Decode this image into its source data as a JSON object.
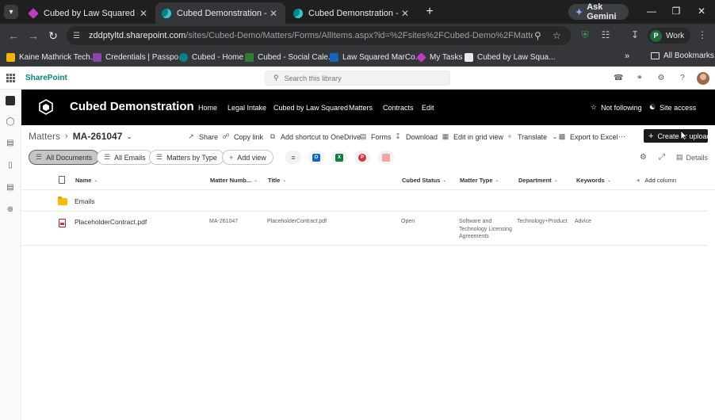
{
  "browser": {
    "tabs": [
      {
        "title": "Cubed by Law Squared - Power",
        "favicon": "power-automate-icon",
        "active": false
      },
      {
        "title": "Cubed Demonstration - Matter",
        "favicon": "sharepoint-icon",
        "active": true
      },
      {
        "title": "Cubed Demonstration - Matter",
        "favicon": "sharepoint-icon",
        "active": false
      }
    ],
    "new_tab": "+",
    "gemini_label": "Ask Gemini",
    "url_host": "zddptyltd.sharepoint.com",
    "url_path": "/sites/Cubed-Demo/Matters/Forms/AllItems.aspx?id=%2Fsites%2FCubed-Demo%2FMatters%2FMA...",
    "profile_initial": "P",
    "profile_label": "Work",
    "bookmarks": [
      {
        "label": "Kaine Mathrick Tech...",
        "color": "#f4b400"
      },
      {
        "label": "Credentials | Passpo...",
        "color": "#8e44ad"
      },
      {
        "label": "Cubed - Home",
        "color": "#038387"
      },
      {
        "label": "Cubed - Social Cale...",
        "color": "#2e7d32"
      },
      {
        "label": "Law Squared MarCo...",
        "color": "#1565c0"
      },
      {
        "label": "My Tasks",
        "color": "#c03bc4"
      },
      {
        "label": "Cubed by Law Squa...",
        "color": "#e8eaed"
      }
    ],
    "bookmarks_more": "»",
    "all_bookmarks": "All Bookmarks"
  },
  "suite": {
    "brand": "SharePoint",
    "search_placeholder": "Search this library"
  },
  "site": {
    "title": "Cubed Demonstration",
    "nav": [
      "Home",
      "Legal Intake",
      "Cubed by Law Squared",
      "Matters",
      "Contracts",
      "Edit"
    ],
    "follow_label": "Not following",
    "access_label": "Site access"
  },
  "commandbar": {
    "breadcrumb_root": "Matters",
    "breadcrumb_current": "MA-261047",
    "commands": [
      "Share",
      "Copy link",
      "Add shortcut to OneDrive",
      "Forms",
      "Download",
      "Edit in grid view",
      "Translate",
      "Export to Excel"
    ],
    "more": "···",
    "create_label": "Create or upload"
  },
  "views": {
    "pills": [
      "All Documents",
      "All Emails",
      "Matters by Type",
      "Add view"
    ],
    "active": "All Documents",
    "quick_filters": [
      {
        "name": "outlook",
        "letter": "O",
        "color": "#0f6cbd"
      },
      {
        "name": "excel",
        "letter": "X",
        "color": "#107c41"
      },
      {
        "name": "pdf",
        "letter": "P",
        "color": "#d13438"
      },
      {
        "name": "other",
        "letter": "",
        "color": "#f1a5a5"
      }
    ],
    "details_label": "Details"
  },
  "list": {
    "columns": [
      "Name",
      "Matter Numb...",
      "Title",
      "Cubed Status",
      "Matter Type",
      "Department",
      "Keywords"
    ],
    "add_column": "Add column",
    "rows": [
      {
        "type": "folder",
        "name": "Emails",
        "matter_number": "",
        "title": "",
        "status": "",
        "matter_type": "",
        "department": "",
        "keywords": ""
      },
      {
        "type": "pdf",
        "name": "PlaceholderContract.pdf",
        "matter_number": "MA-261047",
        "title": "PlaceholderContract.pdf",
        "status": "Open",
        "matter_type": "Software and Technology Licensing Agreements",
        "department": "Technology+Product",
        "keywords": "Advice"
      }
    ]
  }
}
